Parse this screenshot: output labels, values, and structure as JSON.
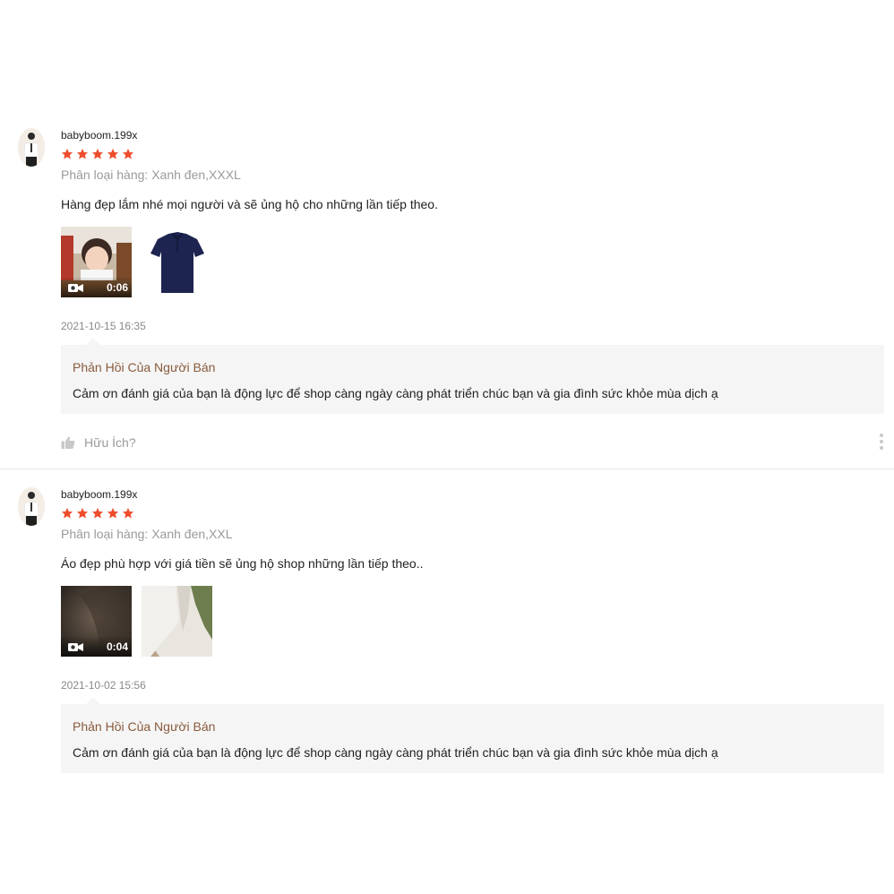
{
  "reviews": [
    {
      "username": "babyboom.199x",
      "rating": 5,
      "variant": "Phân loại hàng: Xanh đen,XXXL",
      "comment": "Hàng đẹp lắm nhé mọi người và sẽ ủng hộ cho những lần tiếp theo.",
      "video_duration": "0:06",
      "timestamp": "2021-10-15 16:35",
      "reply_title": "Phản Hồi Của Người Bán",
      "reply_text": "Cảm ơn đánh giá của bạn là động lực để shop càng ngày càng phát triển chúc bạn và gia đình sức khỏe mùa dịch ạ",
      "helpful_label": "Hữu Ích?"
    },
    {
      "username": "babyboom.199x",
      "rating": 5,
      "variant": "Phân loại hàng: Xanh đen,XXL",
      "comment": "Áo đẹp phù hợp với giá tiền sẽ ủng hộ shop những lần tiếp theo..",
      "video_duration": "0:04",
      "timestamp": "2021-10-02 15:56",
      "reply_title": "Phản Hồi Của Người Bán",
      "reply_text": "Cảm ơn đánh giá của bạn là động lực để shop càng ngày càng phát triển chúc bạn và gia đình sức khỏe mùa dịch ạ"
    }
  ],
  "colors": {
    "star": "#ee4d2d",
    "reply_title": "#8a5a3c",
    "reply_bg": "#f5f5f5",
    "muted_text": "#9a9a9a"
  },
  "icons": [
    "star-icon",
    "video-camera-icon",
    "thumbs-up-icon",
    "more-vertical-icon"
  ]
}
